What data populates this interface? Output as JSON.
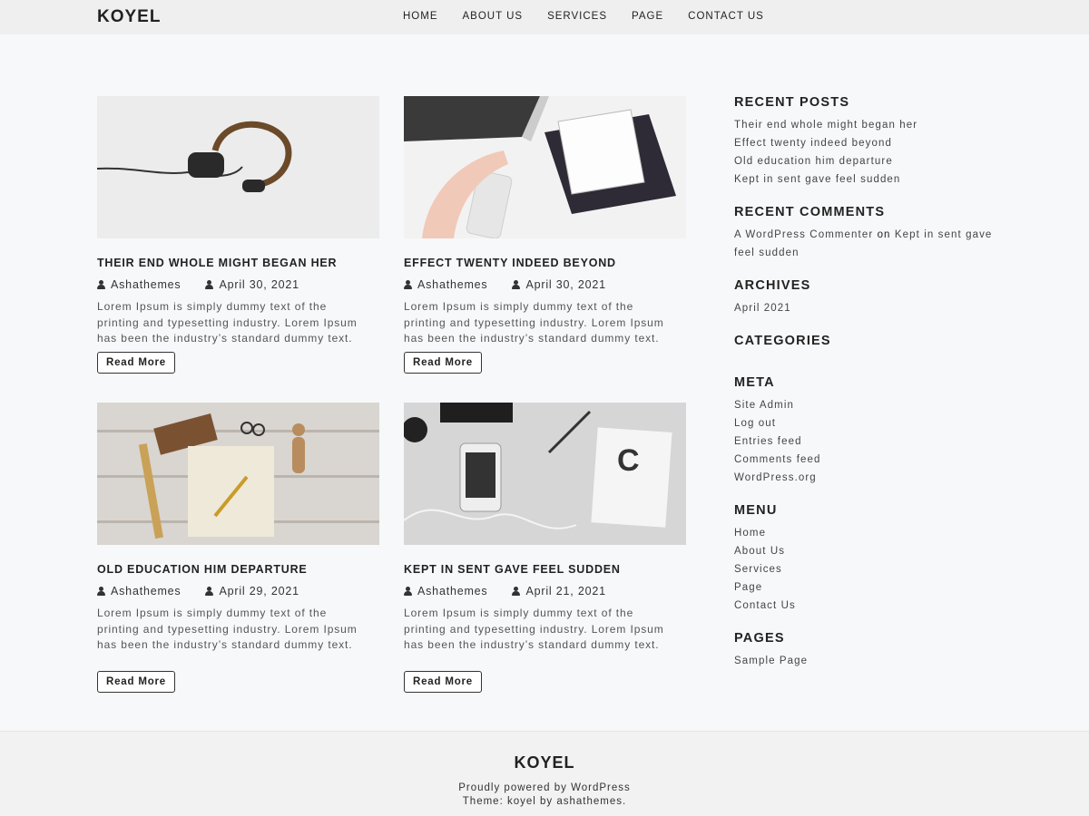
{
  "site": {
    "logo": "KOYEL"
  },
  "nav": [
    "HOME",
    "ABOUT US",
    "SERVICES",
    "PAGE",
    "CONTACT US"
  ],
  "posts": [
    {
      "title": "THEIR END WHOLE MIGHT BEGAN HER",
      "author": "Ashathemes",
      "date": "April 30, 2021",
      "excerpt": "Lorem Ipsum is simply dummy text of the printing and typesetting industry. Lorem Ipsum has been the industry’s standard dummy text.",
      "button": "Read More"
    },
    {
      "title": "EFFECT TWENTY INDEED BEYOND",
      "author": "Ashathemes",
      "date": "April 30, 2021",
      "excerpt": "Lorem Ipsum is simply dummy text of the printing and typesetting industry. Lorem Ipsum has been the industry’s standard dummy text.",
      "button": "Read More"
    },
    {
      "title": "OLD EDUCATION HIM DEPARTURE",
      "author": "Ashathemes",
      "date": "April 29, 2021",
      "excerpt": "Lorem Ipsum is simply dummy text of the printing and typesetting industry. Lorem Ipsum has been the industry’s standard dummy text.",
      "button": "Read More"
    },
    {
      "title": "KEPT IN SENT GAVE FEEL SUDDEN",
      "author": "Ashathemes",
      "date": "April 21, 2021",
      "excerpt": "Lorem Ipsum is simply dummy text of the printing and typesetting industry. Lorem Ipsum has been the industry’s standard dummy text.",
      "button": "Read More"
    }
  ],
  "sidebar": {
    "recent_posts": {
      "title": "RECENT POSTS",
      "items": [
        "Their end whole might began her",
        "Effect twenty indeed beyond",
        "Old education him departure",
        "Kept in sent gave feel sudden"
      ]
    },
    "recent_comments": {
      "title": "RECENT COMMENTS",
      "author": "A WordPress Commenter",
      "on": "on",
      "post": "Kept in sent gave feel sudden"
    },
    "archives": {
      "title": "ARCHIVES",
      "items": [
        "April 2021"
      ]
    },
    "categories": {
      "title": "CATEGORIES"
    },
    "meta": {
      "title": "META",
      "items": [
        "Site Admin",
        "Log out",
        "Entries feed",
        "Comments feed",
        "WordPress.org"
      ]
    },
    "menu": {
      "title": "MENU",
      "items": [
        "Home",
        "About Us",
        "Services",
        "Page",
        "Contact Us"
      ]
    },
    "pages": {
      "title": "PAGES",
      "items": [
        "Sample Page"
      ]
    }
  },
  "footer": {
    "logo": "KOYEL",
    "powered": "Proudly powered by WordPress",
    "theme": "Theme: koyel by ashathemes."
  }
}
